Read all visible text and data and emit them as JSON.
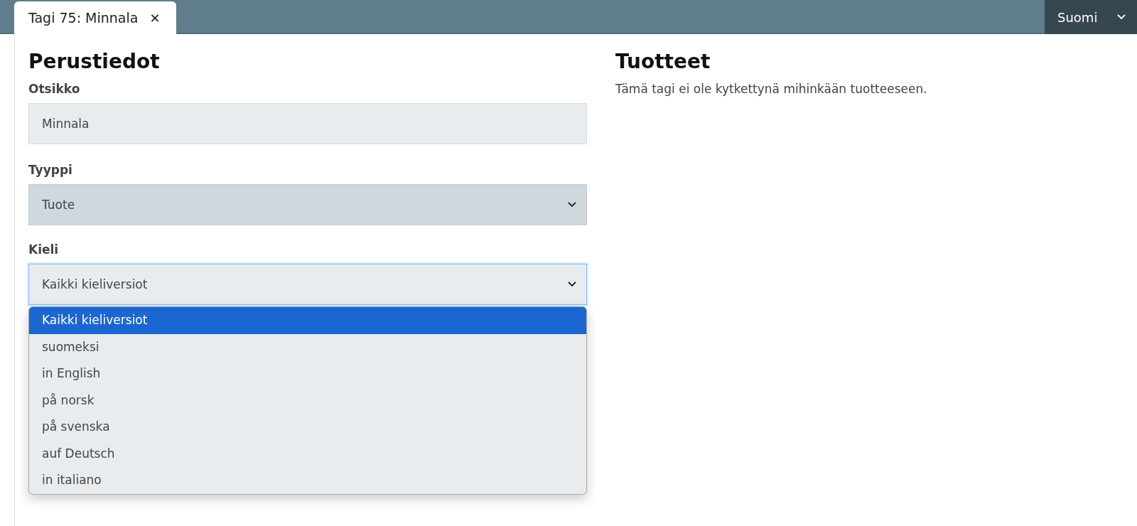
{
  "tabs": [
    {
      "label": "Tagi 75: Minnala",
      "selected": true,
      "close": "✕"
    }
  ],
  "language_select": {
    "value": "Suomi"
  },
  "basic_info": {
    "heading": "Perustiedot",
    "title_field": {
      "label": "Otsikko",
      "value": "Minnala"
    },
    "type_field": {
      "label": "Tyyppi",
      "value": "Tuote"
    },
    "language_field": {
      "label": "Kieli",
      "value": "Kaikki kieliversiot",
      "expanded": true,
      "options": [
        {
          "label": "Kaikki kieliversiot",
          "selected": true
        },
        {
          "label": "suomeksi",
          "selected": false
        },
        {
          "label": "in English",
          "selected": false
        },
        {
          "label": "på norsk",
          "selected": false
        },
        {
          "label": "på svenska",
          "selected": false
        },
        {
          "label": "auf Deutsch",
          "selected": false
        },
        {
          "label": "in italiano",
          "selected": false
        }
      ]
    }
  },
  "products": {
    "heading": "Tuotteet",
    "message": "Tämä tagi ei ole kytkettynä mihinkään tuotteeseen."
  }
}
